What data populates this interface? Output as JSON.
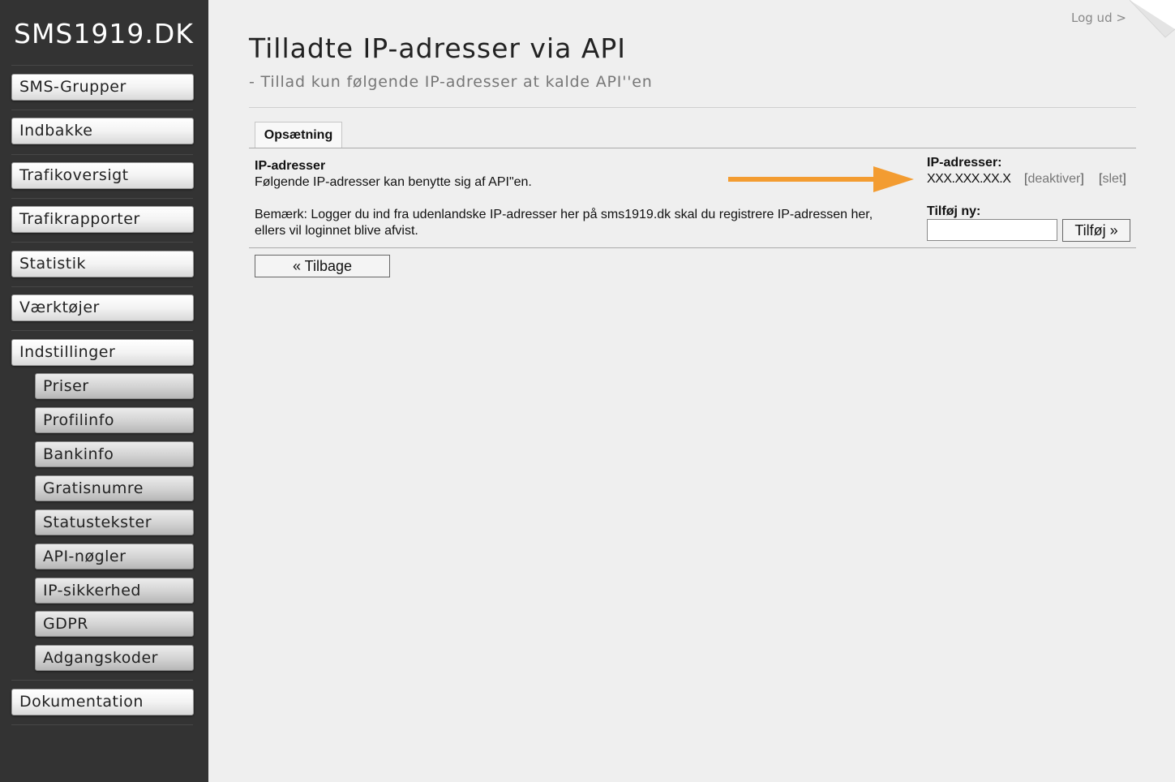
{
  "brand": {
    "logo_text": "SMS1919.DK"
  },
  "header": {
    "logout_label": "Log ud >",
    "title": "Tilladte IP-adresser via API",
    "subtitle": "- Tillad kun følgende IP-adresser at kalde API''en"
  },
  "sidebar": {
    "items": [
      {
        "label": "SMS-Grupper"
      },
      {
        "label": "Indbakke"
      },
      {
        "label": "Trafikoversigt"
      },
      {
        "label": "Trafikrapporter"
      },
      {
        "label": "Statistik"
      },
      {
        "label": "Værktøjer"
      },
      {
        "label": "Indstillinger"
      },
      {
        "label": "Dokumentation"
      }
    ],
    "sub_items": [
      {
        "label": "Priser"
      },
      {
        "label": "Profilinfo"
      },
      {
        "label": "Bankinfo"
      },
      {
        "label": "Gratisnumre"
      },
      {
        "label": "Statustekster"
      },
      {
        "label": "API-nøgler"
      },
      {
        "label": "IP-sikkerhed"
      },
      {
        "label": "GDPR"
      },
      {
        "label": "Adgangskoder"
      }
    ]
  },
  "tabs": [
    {
      "label": "Opsætning"
    }
  ],
  "panel": {
    "section_title": "IP-adresser",
    "description": "Følgende IP-adresser kan benytte sig af API\"en.",
    "note_line1": "Bemærk: Logger du ind fra udenlandske IP-adresser her på sms1919.dk skal du registrere IP-adressen her,",
    "note_line2": "ellers vil loginnet blive afvist.",
    "ip_list_label": "IP-adresser:",
    "ips": [
      {
        "address": "XXX.XXX.XX.X",
        "deactivate_label": "deaktiver",
        "delete_label": "slet"
      }
    ],
    "add_new_label": "Tilføj ny:",
    "new_ip_value": "",
    "add_button_label": "Tilføj »"
  },
  "back_button_label": "« Tilbage",
  "colors": {
    "sidebar_bg": "#333333",
    "page_bg": "#efefef",
    "arrow": "#f39c31"
  }
}
